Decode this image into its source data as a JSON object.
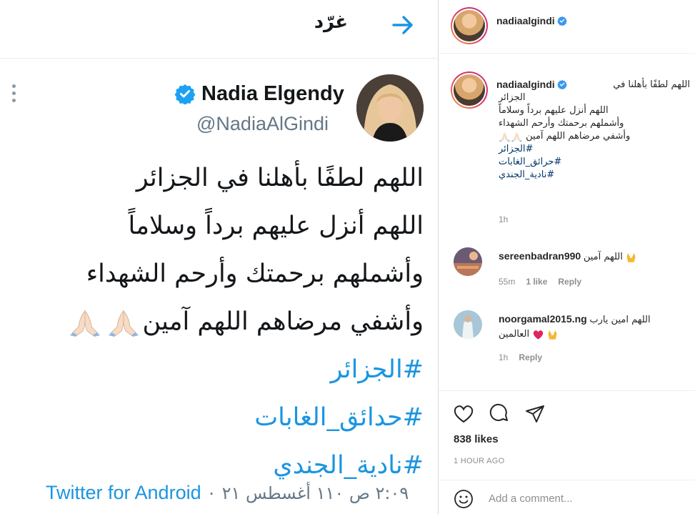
{
  "tweet": {
    "header_title": "غرّد",
    "name": "Nadia Elgendy",
    "handle": "@NadiaAlGindi",
    "lines": [
      "اللهم لطفًا بأهلنا في الجزائر",
      "اللهم أنزل عليهم برداً وسلاماً",
      "وأشملهم برحمتك وأرحم الشهداء",
      "وأشفي مرضاهم اللهم آمين"
    ],
    "hashtags": [
      "#الجزائر",
      "#حدائق_الغابات",
      "#نادية_الجندي"
    ],
    "date": "٢:٠٩ ص ١١٠ أغسطس ٢١",
    "separator": "·",
    "source": "Twitter for Android",
    "link_color": "#1b95e0"
  },
  "header": {
    "username": "nadiaalgindi"
  },
  "caption": {
    "username": "nadiaalgindi",
    "first_line": "اللهم لطفًا بأهلنا في",
    "lines": [
      "الجزائر",
      "اللهم أنزل عليهم برداً وسلاماً",
      "وأشملهم برحمتك وأرحم الشهداء",
      "وأشفي مرضاهم اللهم آمين"
    ],
    "hashtags": [
      "#الجزائر",
      "#حرائق_الغابات",
      "#نادية_الجندي"
    ],
    "time": "1h"
  },
  "comments": [
    {
      "username": "sereenbadran990",
      "text": "اللهم آمين",
      "time": "55m",
      "likes": "1 like",
      "reply": "Reply"
    },
    {
      "username": "noorgamal2015.ng",
      "text": "اللهم امين يارب",
      "text2": "العالمين",
      "time": "1h",
      "reply": "Reply"
    }
  ],
  "actions": {
    "likes": "838 likes",
    "post_time": "1 HOUR AGO"
  },
  "add_comment": {
    "placeholder": "Add a comment..."
  }
}
